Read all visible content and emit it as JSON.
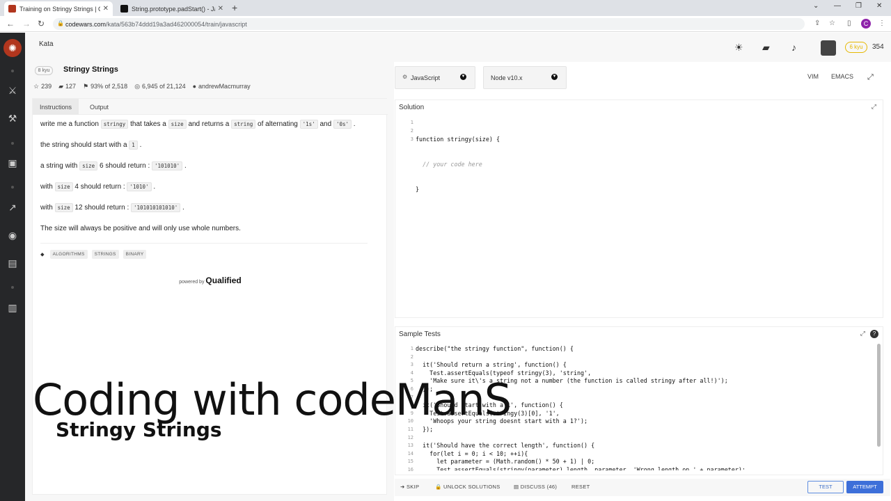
{
  "browser": {
    "tabs": [
      {
        "title": "Training on Stringy Strings | Cod",
        "close": "✕",
        "active": true,
        "favicon_color": "#b1361e"
      },
      {
        "title": "String.prototype.padStart() - Java",
        "close": "✕",
        "active": false,
        "favicon_color": "#111111"
      }
    ],
    "new_tab": "+",
    "url_host": "codewars.com",
    "url_path": "/kata/563b74ddd19a3ad462000054/train/javascript",
    "profile_initial": "C"
  },
  "topbar": {
    "kata_link": "Kata",
    "rank": "6 kyu",
    "honor": "354"
  },
  "kata": {
    "kyu": "8 kyu",
    "title": "Stringy Strings",
    "stats": {
      "stars": "239",
      "favorites": "127",
      "satisfaction": "93% of 2,518",
      "completed": "6,945 of 21,124",
      "author": "andrewMacmurray"
    }
  },
  "instructions": {
    "tabs": [
      "Instructions",
      "Output"
    ],
    "p1_pre": "write me a function",
    "p1_code1": "stringy",
    "p1_mid1": "that takes a",
    "p1_code2": "size",
    "p1_mid2": "and returns a",
    "p1_code3": "string",
    "p1_mid3": "of alternating",
    "p1_code4": "'1s'",
    "p1_mid4": "and",
    "p1_code5": "'0s'",
    "p1_end": ".",
    "p2_pre": "the string should start with a",
    "p2_code": "1",
    "p2_end": ".",
    "p3_pre": "a string with",
    "p3_code1": "size",
    "p3_mid": "6 should return :",
    "p3_code2": "'101010'",
    "p3_end": ".",
    "p4_pre": "with",
    "p4_code1": "size",
    "p4_mid": "4 should return :",
    "p4_code2": "'1010'",
    "p4_end": ".",
    "p5_pre": "with",
    "p5_code1": "size",
    "p5_mid": "12 should return :",
    "p5_code2": "'101010101010'",
    "p5_end": ".",
    "p6": "The size will always be positive and will only use whole numbers.",
    "tags": [
      "ALGORITHMS",
      "STRINGS",
      "BINARY"
    ],
    "powered_by": "powered by",
    "qualified": "Qualified"
  },
  "editor_controls": {
    "language": "JavaScript",
    "runtime": "Node v10.x",
    "vim": "VIM",
    "emacs": "EMACS"
  },
  "solution": {
    "title": "Solution",
    "line_numbers": [
      "1",
      "2",
      "3"
    ],
    "lines": [
      "function stringy(size) {",
      "  // your code here",
      "}"
    ]
  },
  "sample_tests": {
    "title": "Sample Tests",
    "line_numbers": [
      "1",
      "2",
      "3",
      "4",
      "5",
      "6",
      "7",
      "8",
      "9",
      "10",
      "11",
      "12",
      "13",
      "14",
      "15",
      "16"
    ],
    "lines": [
      "describe(\"the stringy function\", function() {",
      "",
      "  it('Should return a string', function() {",
      "    Test.assertEquals(typeof stringy(3), 'string',",
      "    'Make sure it\\'s a string not a number (the function is called stringy after all!)');",
      "  });",
      "",
      "  it('Should start with a 1', function() {",
      "    Test.assertEquals(stringy(3)[0], '1',",
      "    'Whoops your string doesnt start with a 1?');",
      "  });",
      "",
      "  it('Should have the correct length', function() {",
      "    for(let i = 0; i < 10; ++i){",
      "      let parameter = (Math.random() * 50 + 1) | 0;",
      "      Test.assertEquals(stringy(parameter).length, parameter, 'Wrong length on ' + parameter);"
    ]
  },
  "bottom": {
    "skip": "SKIP",
    "unlock": "UNLOCK SOLUTIONS",
    "discuss": "DISCUSS (46)",
    "reset": "RESET",
    "test": "TEST",
    "attempt": "ATTEMPT"
  },
  "overlay": {
    "title": "Coding with codeManS",
    "subtitle": "Stringy Strings"
  },
  "colors": {
    "accent": "#3d6fd9",
    "sidebar": "#262729",
    "rank": "#e6b800",
    "brand": "#b1361e"
  }
}
